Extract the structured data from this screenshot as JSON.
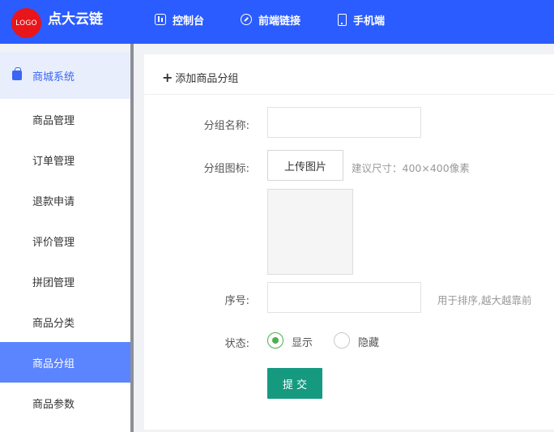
{
  "header": {
    "logo_text": "LOGO",
    "brand": "点大云链",
    "nav": {
      "control": "控制台",
      "frontend_link": "前端链接",
      "mobile": "手机端"
    }
  },
  "sidebar": {
    "section": "商城系统",
    "items": [
      "商品管理",
      "订单管理",
      "退款申请",
      "评价管理",
      "拼团管理",
      "商品分类",
      "商品分组",
      "商品参数"
    ],
    "active": "商品分组"
  },
  "form": {
    "header_action": "添加商品分组",
    "name_label": "分组名称:",
    "name_value": "",
    "icon_label": "分组图标:",
    "upload_button": "上传图片",
    "icon_hint": "建议尺寸：400×400像素",
    "order_label": "序号:",
    "order_value": "",
    "order_hint": "用于排序,越大越靠前",
    "status_label": "状态:",
    "status_options": [
      "显示",
      "隐藏"
    ],
    "status_selected": "显示",
    "submit": "提 交"
  },
  "colors": {
    "header_bg": "#2b5cff",
    "active_item": "#5b84ff",
    "submit_bg": "#159a80",
    "radio_checked": "#4caf50"
  }
}
